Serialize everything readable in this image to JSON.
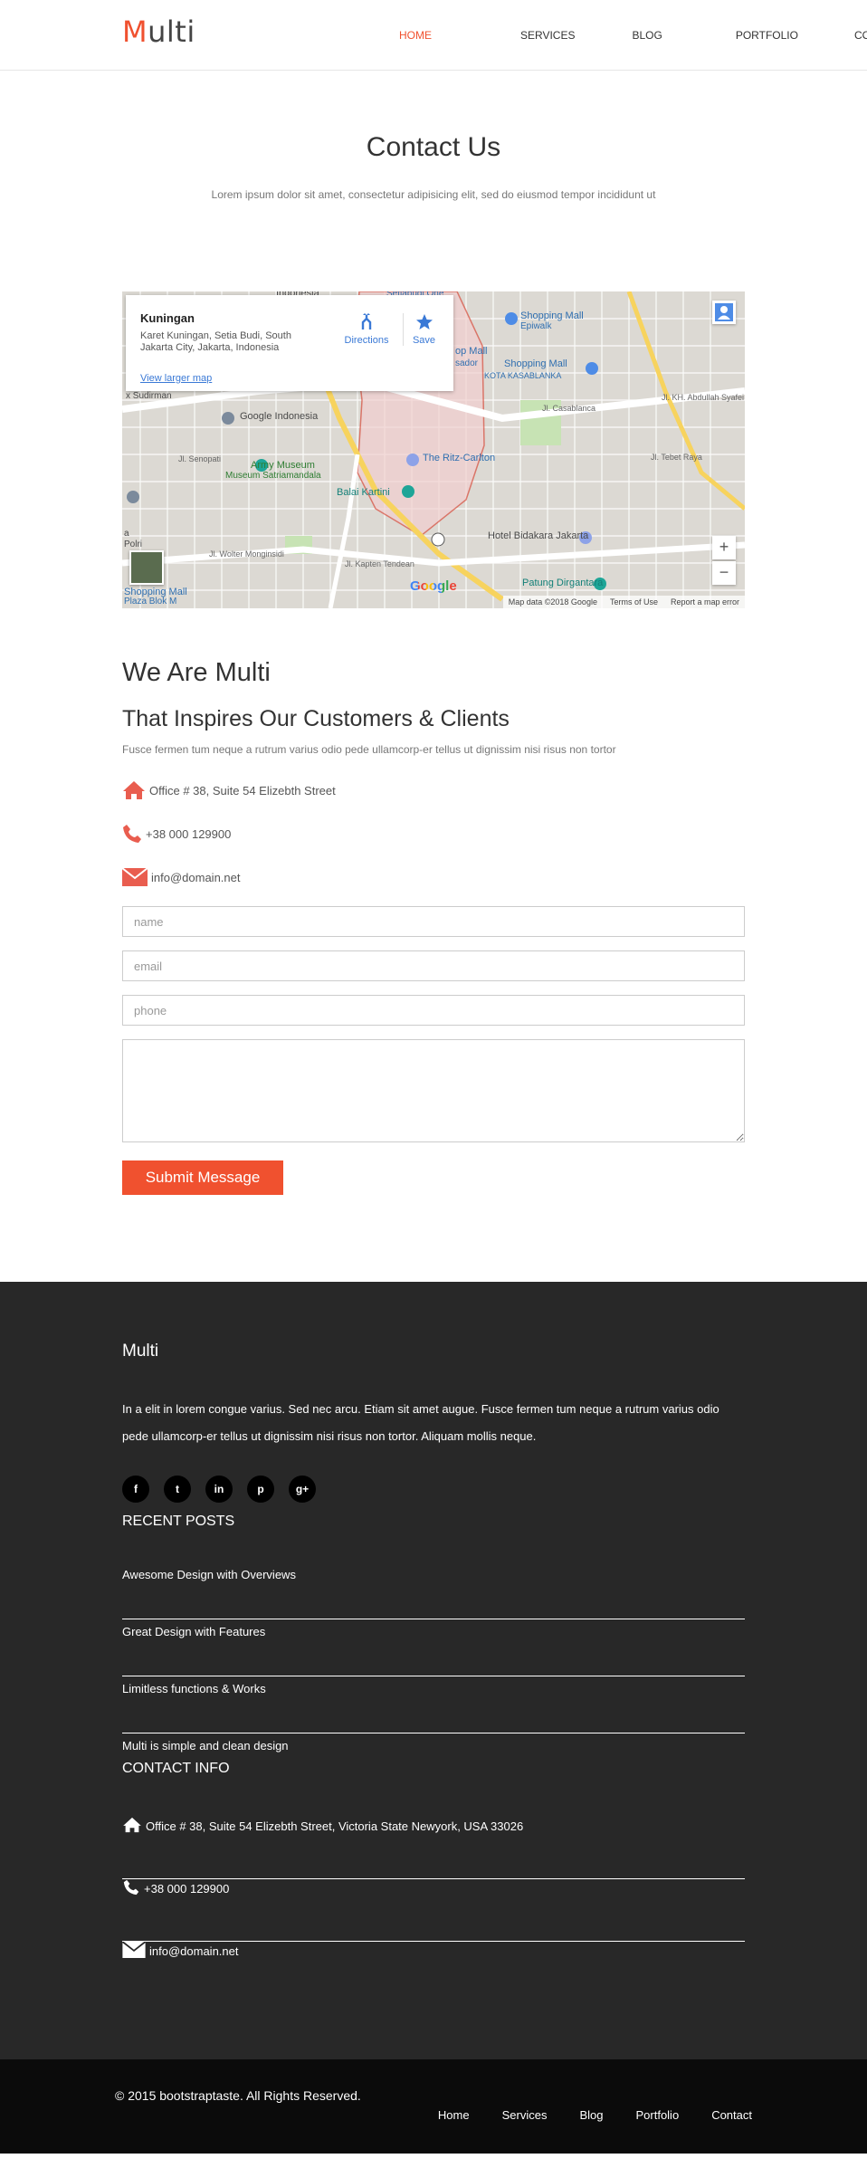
{
  "nav": {
    "brand_first": "M",
    "brand_rest": "ulti",
    "items": [
      {
        "label": "HOME",
        "active": true
      },
      {
        "label": "SERVICES",
        "active": false
      },
      {
        "label": "BLOG",
        "active": false
      },
      {
        "label": "PORTFOLIO",
        "active": false
      },
      {
        "label": "CONTACT",
        "active": false
      }
    ]
  },
  "contact": {
    "title": "Contact Us",
    "subtitle": "Lorem ipsum dolor sit amet, consectetur adipisicing elit, sed do eiusmod tempor incididunt ut"
  },
  "map": {
    "place": "Kuningan",
    "address": "Karet Kuningan, Setia Budi, South Jakarta City, Jakarta, Indonesia",
    "larger_map": "View larger map",
    "directions": "Directions",
    "save": "Save",
    "labels": {
      "indonesia": "Indonesia",
      "setiabudi": "Setiabudi One",
      "shopping_epiwalk": "Shopping Mall",
      "epiwalk": "Epiwalk",
      "google_indonesia": "Google Indonesia",
      "sudirman": "x Sudirman",
      "shopping_kk": "Shopping Mall",
      "kota_kasablanka": "KOTA KASABLANKA",
      "sador": "sador",
      "op_mall": "op Mall",
      "casablanca": "Jl. Casablanca",
      "kh_abdullah": "Jl. KH. Abdullah Syafei",
      "ritz": "The Ritz-Carlton",
      "army_museum": "Army Museum",
      "museum_satria": "Museum Satriamandala",
      "balai_kartini": "Balai Kartini",
      "hotel_bidakara": "Hotel Bidakara Jakarta",
      "wolter": "Jl. Wolter Monginsidi",
      "kapten": "Jl. Kapten Tendean",
      "patung": "Patung Dirgantara",
      "shopping_blok": "Shopping Mall",
      "plaza_blok": "Plaza Blok M",
      "tebet": "Jl. Tebet Raya",
      "senopati": "Jl. Senopati",
      "polri": "Polri",
      "a_label": "a"
    },
    "footer": {
      "data": "Map data ©2018 Google",
      "terms": "Terms of Use",
      "report": "Report a map error"
    },
    "google": "Google",
    "zoom_in": "+",
    "zoom_out": "−"
  },
  "about": {
    "title": "We Are Multi",
    "subtitle": "That Inspires Our Customers & Clients",
    "text": "Fusce fermen tum neque a rutrum varius odio pede ullamcorp-er tellus ut dignissim nisi risus non tortor",
    "address": "Office # 38, Suite 54 Elizebth Street",
    "phone": "+38 000 129900",
    "email": "info@domain.net"
  },
  "form": {
    "name_placeholder": "name",
    "email_placeholder": "email",
    "phone_placeholder": "phone",
    "message_placeholder": "",
    "submit": "Submit Message"
  },
  "footer": {
    "brand": "Multi",
    "description": "In a elit in lorem congue varius. Sed nec arcu. Etiam sit amet augue. Fusce fermen tum neque a rutrum varius odio pede ullamcorp-er tellus ut dignissim nisi risus non tortor. Aliquam mollis neque.",
    "social": [
      "f",
      "t",
      "in",
      "p",
      "g+"
    ],
    "recent_title": "RECENT POSTS",
    "posts": [
      "Awesome Design with Overviews",
      "Great Design with Features",
      "Limitless functions & Works",
      "Multi is simple and clean design"
    ],
    "contact_title": "CONTACT INFO",
    "address": "Office # 38, Suite 54 Elizebth Street, Victoria State Newyork, USA 33026",
    "phone": "+38 000 129900",
    "email": "info@domain.net"
  },
  "bottom": {
    "copyright": "© 2015 bootstraptaste. All Rights Reserved.",
    "links": [
      "Home",
      "Services",
      "Blog",
      "Portfolio",
      "Contact"
    ]
  },
  "colors": {
    "accent": "#f0512f",
    "footer_bg": "#282828",
    "bottom_bg": "#0b0b0b"
  }
}
